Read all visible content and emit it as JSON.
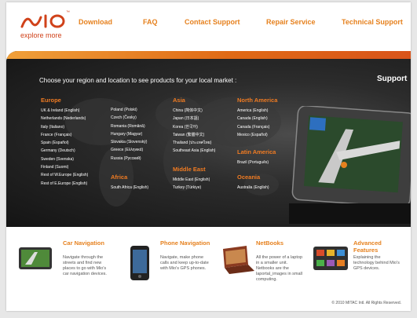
{
  "header": {
    "logo_text": "Mio",
    "logo_tagline": "explore more",
    "nav": [
      "Download",
      "FAQ",
      "Contact Support",
      "Repair Service",
      "Technical Support"
    ]
  },
  "banner": {
    "support_title": "Support",
    "market_prompt": "Choose your region and location to see products for your local market :",
    "regions": {
      "europe": {
        "title": "Europe",
        "col1": [
          "UK & Ireland (English)",
          "Netherlands (Nederlands)",
          "Italy (Italiano)",
          "France (Français)",
          "Spain (Español)",
          "Germany (Deutsch)",
          "Sweden (Svenska)",
          "Finland (Suomi)",
          "Rest of W.Europe (English)",
          "Rest of E.Europe (English)"
        ],
        "col2": [
          "Poland (Polski)",
          "Czech (Česky)",
          "Romania (Română)",
          "Hungary (Magyar)",
          "Slovakia (Slovenský)",
          "Greece (Ελληνικά)",
          "Russia (Русский)"
        ]
      },
      "africa": {
        "title": "Africa",
        "items": [
          "South Africa (English)"
        ]
      },
      "asia": {
        "title": "Asia",
        "items": [
          "China (简体中文)",
          "Japan (日本語)",
          "Korea (한국어)",
          "Taiwan (繁體中文)",
          "Thailand (ประเทศไทย)",
          "Southeast Asia (English)"
        ]
      },
      "middle_east": {
        "title": "Middle East",
        "items": [
          "Middle East (English)",
          "Turkey (Türkiye)"
        ]
      },
      "north_america": {
        "title": "North America",
        "items": [
          "America (English)",
          "Canada (English)",
          "Canada (Français)",
          "Mexico (Español)"
        ]
      },
      "latin_america": {
        "title": "Latin America",
        "items": [
          "Brazil (Português)"
        ]
      },
      "oceania": {
        "title": "Oceania",
        "items": [
          "Australia (English)"
        ]
      }
    }
  },
  "features": [
    {
      "title": "Car Navigation",
      "description": "Navigate through the streets and find new places to go with Mio's car navigation devices."
    },
    {
      "title": "Phone Navigation",
      "description": "Navigate, make phone calls and keep up-to-date with Mio's GPS phones."
    },
    {
      "title": "NetBooks",
      "description": "All the power of a laptop in a smaller unit. Netbooks are the laportal_images in small computing."
    },
    {
      "title": "Advanced Features",
      "description": "Explaining the technology behind Mio's GPS devices."
    }
  ],
  "footer": {
    "copyright": "© 2010 MITAC Intl. All Rights Reserved."
  },
  "colors": {
    "accent": "#e6811e",
    "brand": "#d0421a",
    "banner_bg": "#1d1d1d"
  }
}
